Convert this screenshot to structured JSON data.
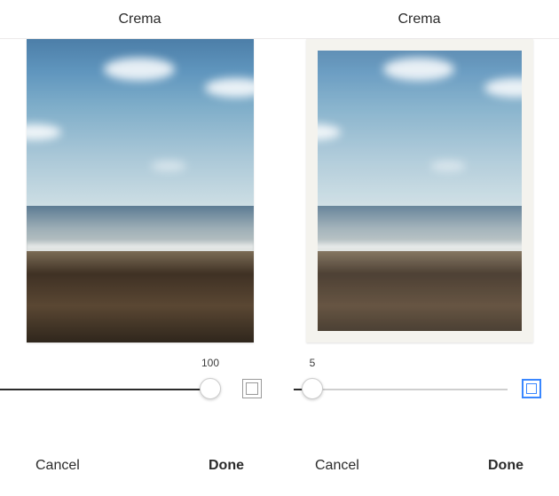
{
  "panes": [
    {
      "title": "Crema",
      "slider": {
        "value": 100,
        "min": 0,
        "max": 100
      },
      "frame_active": false,
      "cancel_label": "Cancel",
      "done_label": "Done"
    },
    {
      "title": "Crema",
      "slider": {
        "value": 5,
        "min": 0,
        "max": 100
      },
      "frame_active": true,
      "cancel_label": "Cancel",
      "done_label": "Done"
    }
  ]
}
